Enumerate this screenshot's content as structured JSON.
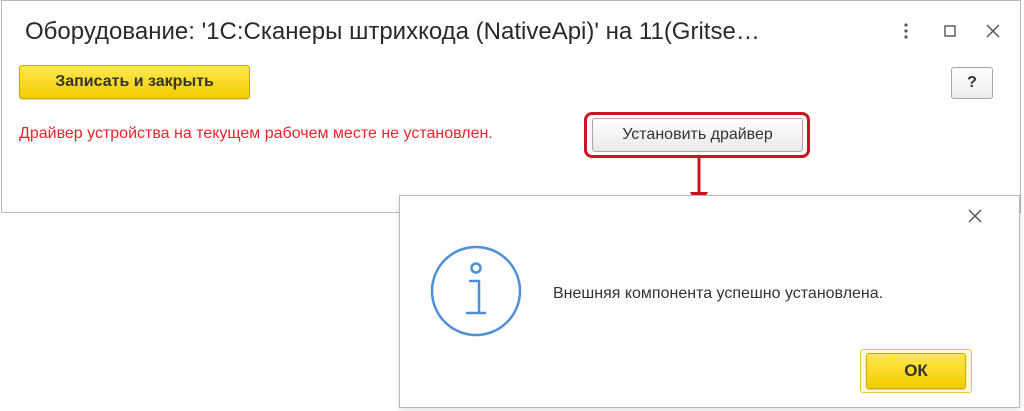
{
  "window": {
    "title": "Оборудование: '1С:Сканеры штрихкода (NativeApi)' на 11(Gritse…",
    "controls": {
      "more": "more-vertical-icon",
      "maximize": "maximize-icon",
      "close": "close-icon"
    }
  },
  "toolbar": {
    "save_close_label": "Записать и закрыть",
    "help_label": "?"
  },
  "driver": {
    "warning_text": "Драйвер устройства на текущем рабочем месте не установлен.",
    "install_label": "Установить драйвер"
  },
  "dialog": {
    "message": "Внешняя компонента успешно установлена.",
    "ok_label": "ОК",
    "icon": "info-icon"
  },
  "colors": {
    "accent_yellow": "#f7d21a",
    "warning_red": "#e8242c",
    "highlight_red": "#c8151f",
    "info_blue": "#4f8fd6"
  }
}
